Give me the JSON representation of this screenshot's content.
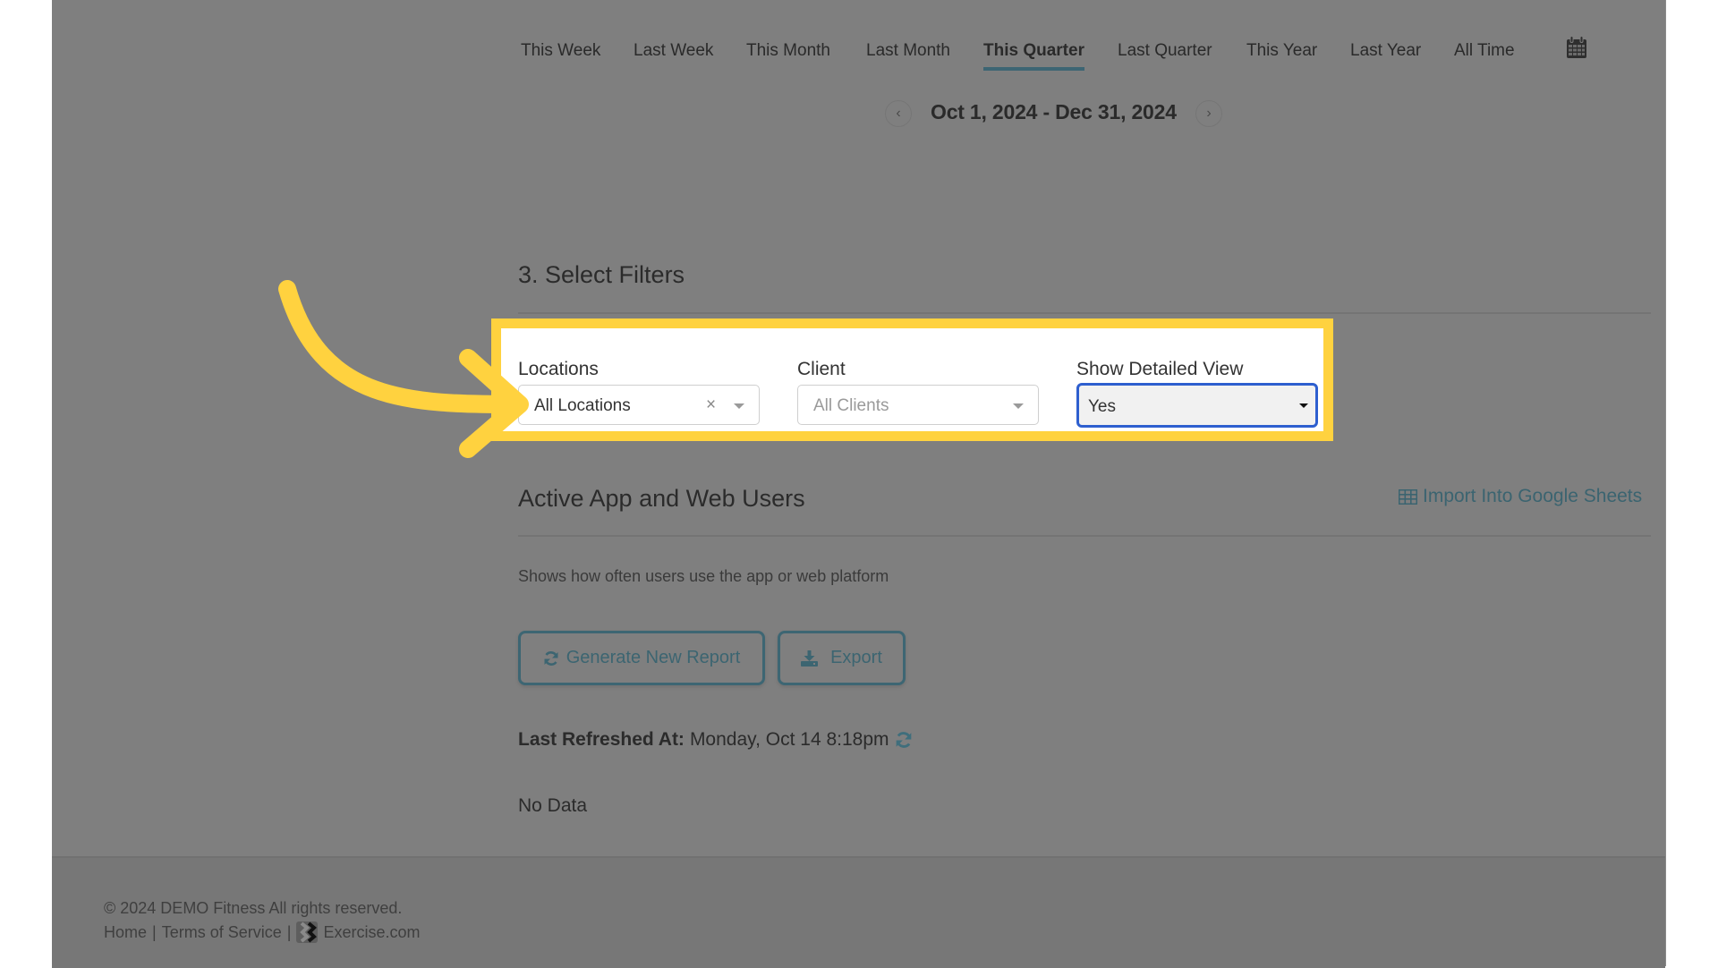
{
  "date_range_tabs": [
    {
      "label": "This Week",
      "active": false
    },
    {
      "label": "Last Week",
      "active": false
    },
    {
      "label": "This Month",
      "active": false
    },
    {
      "label": "Last Month",
      "active": false
    },
    {
      "label": "This Quarter",
      "active": true
    },
    {
      "label": "Last Quarter",
      "active": false
    },
    {
      "label": "This Year",
      "active": false
    },
    {
      "label": "Last Year",
      "active": false
    },
    {
      "label": "All Time",
      "active": false
    }
  ],
  "date_picker_icon": "calendar-icon",
  "date_range": {
    "prev_icon": "‹",
    "label": "Oct 1, 2024 - Dec 31, 2024",
    "next_icon": "›"
  },
  "filters": {
    "section_title": "3. Select Filters",
    "locations": {
      "label": "Locations",
      "value": "All Locations",
      "clear_icon": "×"
    },
    "client": {
      "label": "Client",
      "placeholder": "All Clients"
    },
    "detailed_view": {
      "label": "Show Detailed View",
      "value": "Yes"
    }
  },
  "report": {
    "title": "Active App and Web Users",
    "import_link": "Import Into Google Sheets",
    "description": "Shows how often users use the app or web platform",
    "generate_button": "Generate New Report",
    "export_button": "Export",
    "last_refreshed_label": "Last Refreshed At:",
    "last_refreshed_value": "Monday, Oct 14 8:18pm",
    "empty_state": "No Data"
  },
  "footer": {
    "copyright": "© 2024 DEMO Fitness All rights reserved.",
    "links": [
      "Home",
      "Terms of Service"
    ],
    "separator": "|",
    "brand": "Exercise.com"
  },
  "colors": {
    "overlay_gray": "#7f7f7f",
    "highlight_yellow": "#ffd23f",
    "accent_teal": "#3d6673",
    "focus_blue": "#2e5fcf"
  }
}
